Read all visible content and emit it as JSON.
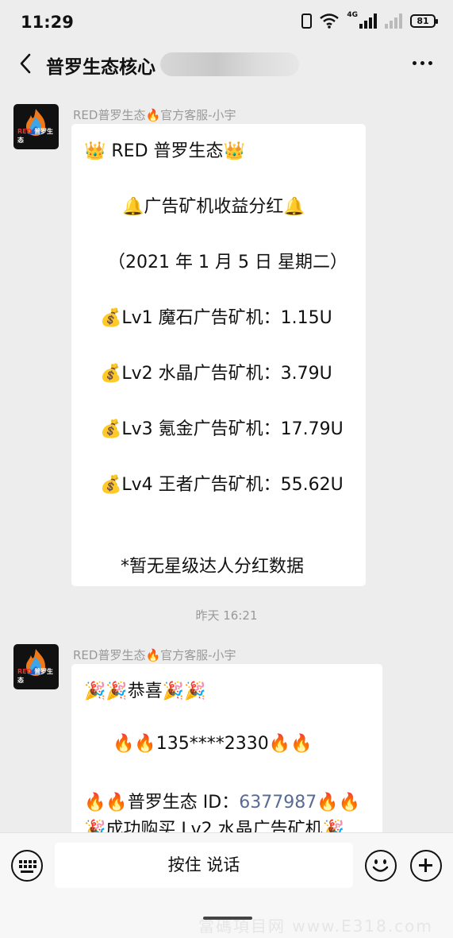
{
  "status_bar": {
    "time": "11:29",
    "network_label": "4G",
    "battery": "81",
    "icons": [
      "vibrate-icon",
      "wifi-icon",
      "signal-icon",
      "signal-secondary-icon",
      "battery-icon"
    ]
  },
  "nav": {
    "title": "普罗生态核心",
    "back_icon": "chevron-left-icon",
    "more_icon": "more-dots-icon"
  },
  "avatar": {
    "logo_red": "RED",
    "logo_text": "普罗生态"
  },
  "messages": [
    {
      "sender": "RED普罗生态🔥官方客服-小宇",
      "lines": [
        "👑 RED 普罗生态👑",
        "🔔广告矿机收益分红🔔",
        "（2021 年 1 月 5 日  星期二）",
        "💰Lv1 魔石广告矿机：1.15U",
        "💰Lv2 水晶广告矿机：3.79U",
        "💰Lv3 氪金广告矿机：17.79U",
        "💰Lv4 王者广告矿机：55.62U",
        "*暂无星级达人分红数据"
      ]
    },
    {
      "sender": "RED普罗生态🔥官方客服-小宇",
      "lines": [
        "🎉🎉恭喜🎉🎉",
        "🔥🔥135****2330🔥🔥",
        "🔥🔥普罗生态 ID：",
        "🎉成功购买 Lv2 水晶广告矿机🎉"
      ],
      "id_value": "6377987",
      "id_suffix": "🔥🔥"
    }
  ],
  "timestamp": "昨天 16:21",
  "input_bar": {
    "voice_label": "按住 说话",
    "keyboard_icon": "keyboard-icon",
    "emoji_icon": "smiley-icon",
    "plus_icon": "plus-circle-icon"
  },
  "watermark": "當碼項目网 www.E318.com"
}
